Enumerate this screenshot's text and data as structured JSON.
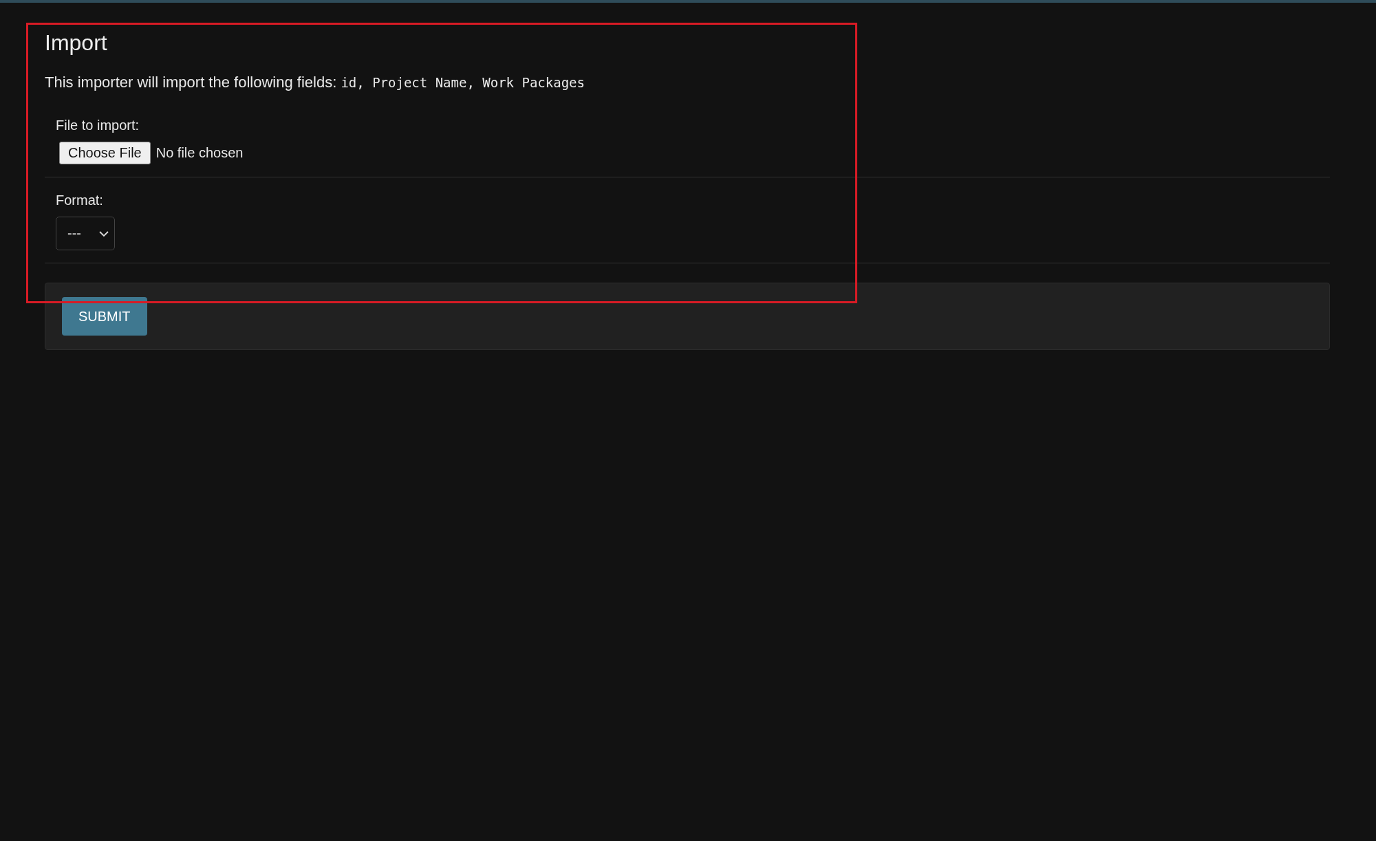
{
  "page": {
    "title": "Import",
    "description": "This importer will import the following fields:",
    "fields": "id, Project Name, Work Packages"
  },
  "form": [
    {
      "kind": "file",
      "label": "File to import:",
      "button": "Choose File",
      "status": "No file chosen"
    },
    {
      "kind": "select",
      "label": "Format:",
      "value": "---"
    }
  ],
  "submit": {
    "label": "SUBMIT"
  },
  "highlight": {
    "on": true
  }
}
